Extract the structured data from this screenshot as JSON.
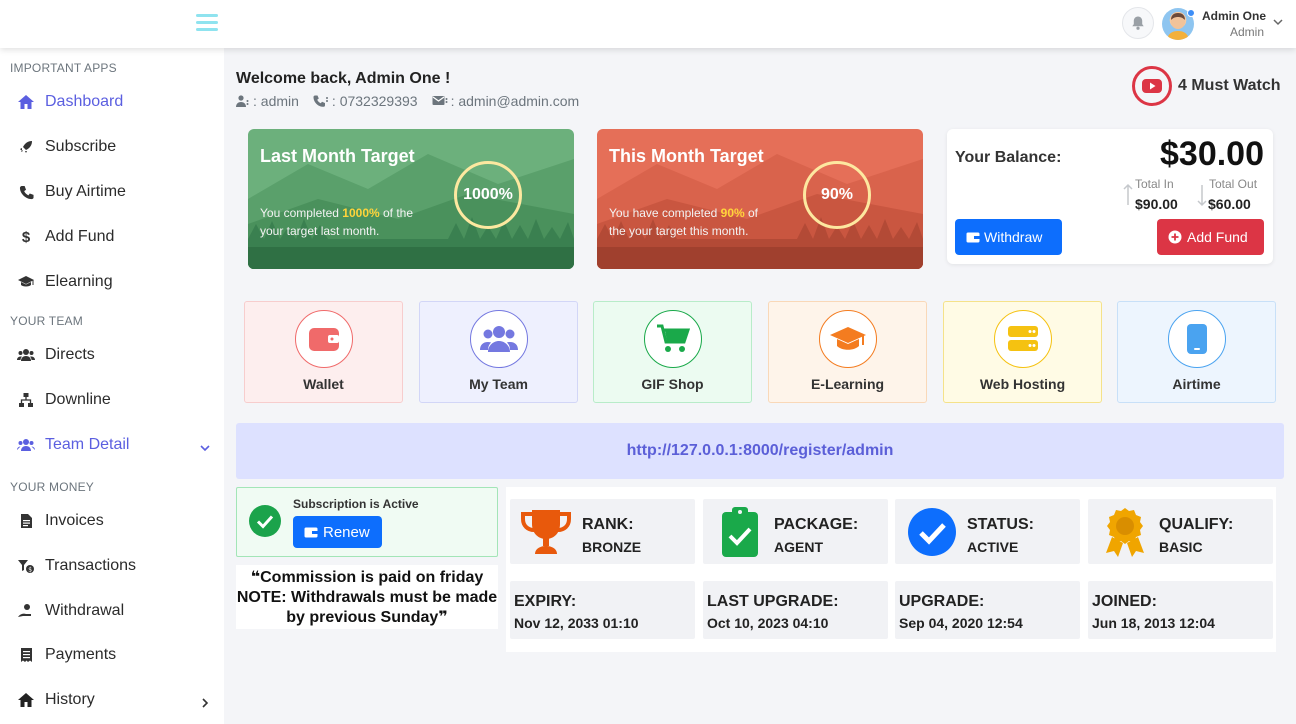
{
  "topbar": {
    "user_name": "Admin One",
    "user_role": "Admin"
  },
  "sidebar": {
    "sections": [
      "IMPORTANT APPS",
      "YOUR TEAM",
      "YOUR MONEY"
    ],
    "items": [
      {
        "label": "Dashboard",
        "icon": "home-icon"
      },
      {
        "label": "Subscribe",
        "icon": "rocket-icon"
      },
      {
        "label": "Buy Airtime",
        "icon": "phone-icon"
      },
      {
        "label": "Add Fund",
        "icon": "dollar-icon"
      },
      {
        "label": "Elearning",
        "icon": "graduation-cap-icon"
      },
      {
        "label": "Directs",
        "icon": "users-icon"
      },
      {
        "label": "Downline",
        "icon": "sitemap-icon"
      },
      {
        "label": "Team Detail",
        "icon": "users-cog-icon"
      },
      {
        "label": "Invoices",
        "icon": "file-invoice-icon"
      },
      {
        "label": "Transactions",
        "icon": "transactions-icon"
      },
      {
        "label": "Withdrawal",
        "icon": "withdraw-icon"
      },
      {
        "label": "Payments",
        "icon": "receipt-icon"
      },
      {
        "label": "History",
        "icon": "home-icon"
      }
    ]
  },
  "welcome": {
    "title": "Welcome back, Admin One !",
    "username": ": admin",
    "phone": ": 0732329393",
    "email": ": admin@admin.com"
  },
  "must_watch": "4 Must Watch",
  "targets": [
    {
      "title": "Last Month Target",
      "pre": "You completed ",
      "pct": "1000%",
      "post": " of the your target last month.",
      "ring": "1000%"
    },
    {
      "title": "This Month Target",
      "pre": "You have completed ",
      "pct": "90%",
      "post": " of the your target this month.",
      "ring": "90%"
    }
  ],
  "balance": {
    "label": "Your Balance:",
    "amount": "$30.00",
    "total_in_label": "Total In",
    "total_in": "$90.00",
    "total_out_label": "Total Out",
    "total_out": "$60.00",
    "withdraw": "Withdraw",
    "add_fund": "Add Fund"
  },
  "tiles": [
    {
      "label": "Wallet",
      "icon": "wallet-icon",
      "color": "#f06a6a"
    },
    {
      "label": "My Team",
      "icon": "users-icon",
      "color": "#7478e0"
    },
    {
      "label": "GIF Shop",
      "icon": "cart-icon",
      "color": "#1aa94a"
    },
    {
      "label": "E-Learning",
      "icon": "graduation-cap-icon",
      "color": "#f47c20"
    },
    {
      "label": "Web Hosting",
      "icon": "server-icon",
      "color": "#f5c211"
    },
    {
      "label": "Airtime",
      "icon": "mobile-icon",
      "color": "#4aa3f0"
    }
  ],
  "referral_link": "http://127.0.0.1:8000/register/admin",
  "subscription": {
    "status": "Subscription is Active",
    "renew": "Renew"
  },
  "commission_note": "Commission is paid on friday NOTE: Withdrawals must be made by previous Sunday",
  "stats": [
    {
      "label": "RANK:",
      "value": "BRONZE",
      "icon": "trophy-icon"
    },
    {
      "label": "PACKAGE:",
      "value": "AGENT",
      "icon": "clipboard-check-icon"
    },
    {
      "label": "STATUS:",
      "value": "ACTIVE",
      "icon": "check-circle-icon"
    },
    {
      "label": "QUALIFY:",
      "value": "BASIC",
      "icon": "award-icon"
    }
  ],
  "dates": [
    {
      "label": "EXPIRY:",
      "value": "Nov 12, 2033 01:10"
    },
    {
      "label": "LAST UPGRADE:",
      "value": "Oct 10, 2023 04:10"
    },
    {
      "label": "UPGRADE:",
      "value": "Sep 04, 2020 12:54"
    },
    {
      "label": "JOINED:",
      "value": "Jun 18, 2013 12:04"
    }
  ]
}
